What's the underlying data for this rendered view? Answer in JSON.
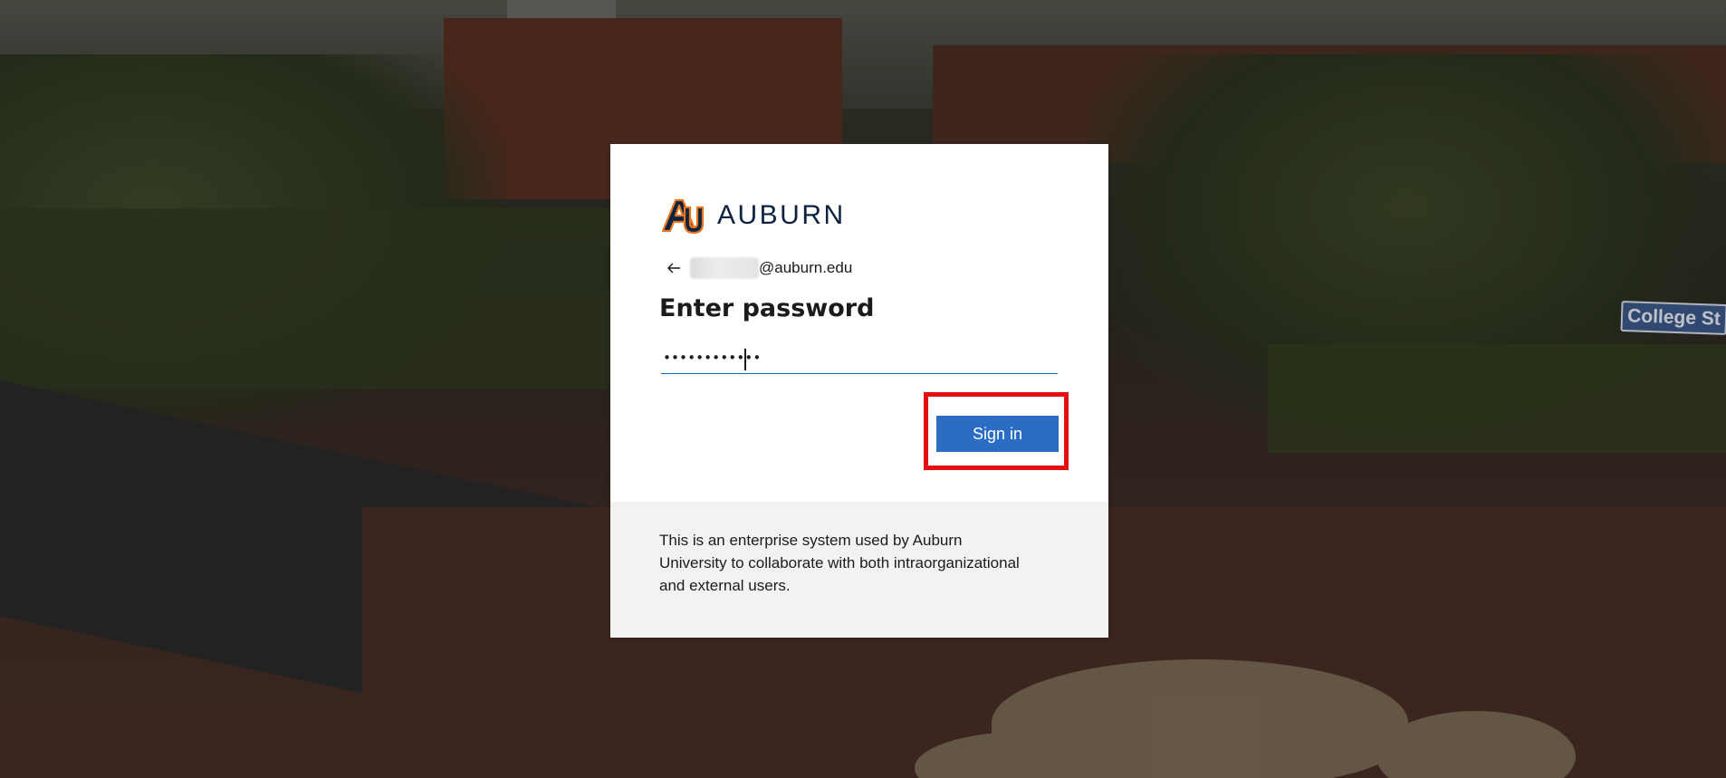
{
  "brand": {
    "name": "AUBURN",
    "logo_icon": "auburn-au-logo",
    "colors": {
      "navy": "#0c2340",
      "orange": "#e87722"
    }
  },
  "background": {
    "street_sign": "College St"
  },
  "signin": {
    "back_icon": "back-arrow-icon",
    "identity_domain": "@auburn.edu",
    "title": "Enter password",
    "password_masked": "••••••••••••",
    "submit_label": "Sign in",
    "accent_color": "#2b6cc4",
    "highlight_color": "#e31010"
  },
  "footer": {
    "text": "This is an enterprise system used by Auburn University to collaborate with both intraorganizational and external users."
  }
}
